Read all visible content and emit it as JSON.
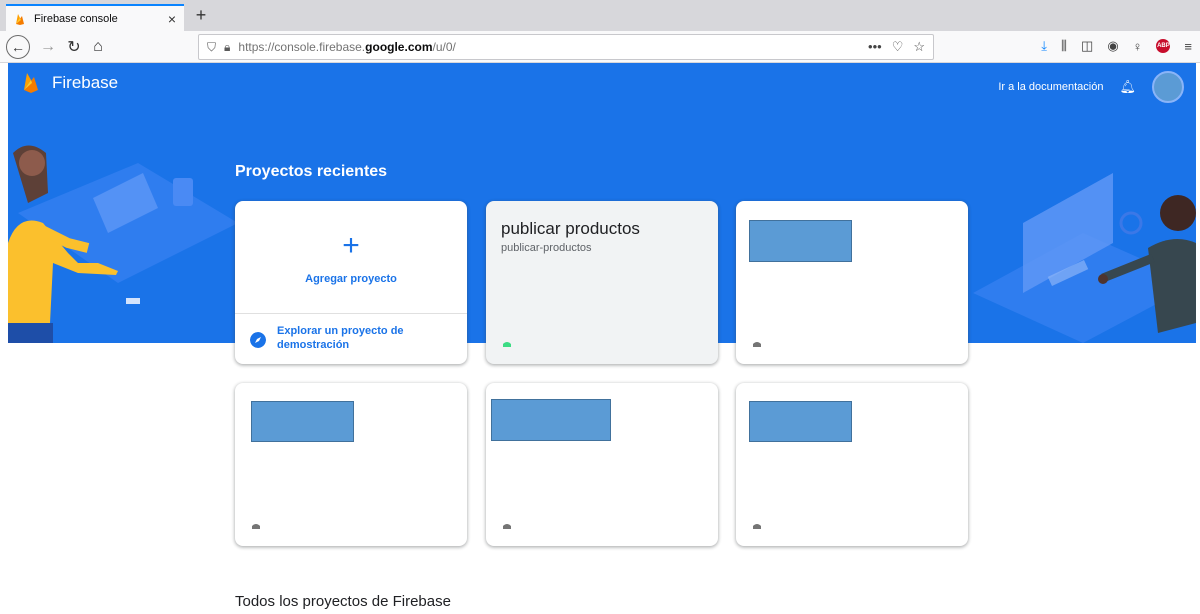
{
  "browser": {
    "tab_title": "Firebase console",
    "tab_close": "×",
    "new_tab": "+",
    "url_prefix": "https://console.firebase.",
    "url_domain": "google.com",
    "url_suffix": "/u/0/",
    "page_actions": "•••"
  },
  "header": {
    "brand": "Firebase",
    "docs_link": "Ir a la documentación"
  },
  "recent": {
    "title": "Proyectos recientes",
    "add_plus": "+",
    "add_label": "Agregar proyecto",
    "demo_label": "Explorar un proyecto de demostración"
  },
  "projects": [
    {
      "name": "publicar productos",
      "id": "publicar-productos",
      "platform_color": "#3ddc84",
      "redacted": false
    },
    {
      "name": "",
      "id": "",
      "platform_color": "#757575",
      "redacted": true
    },
    {
      "name": "",
      "id": "",
      "platform_color": "#757575",
      "redacted": true
    },
    {
      "name": "",
      "id": "",
      "platform_color": "#757575",
      "redacted": true
    },
    {
      "name": "",
      "id": "",
      "platform_color": "#757575",
      "redacted": true
    }
  ],
  "all_projects": {
    "title": "Todos los proyectos de Firebase"
  },
  "colors": {
    "brand_blue": "#1a73e8",
    "redaction": "#5b9bd5"
  }
}
